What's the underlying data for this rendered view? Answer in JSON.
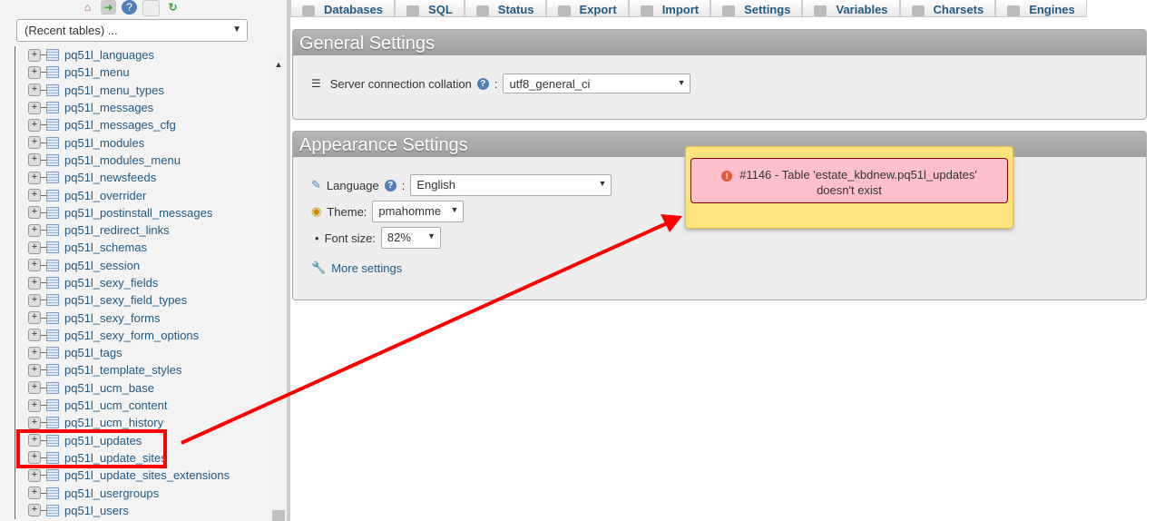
{
  "sidebar": {
    "recent_tables": "(Recent tables) ...",
    "tables": [
      "pq51l_languages",
      "pq51l_menu",
      "pq51l_menu_types",
      "pq51l_messages",
      "pq51l_messages_cfg",
      "pq51l_modules",
      "pq51l_modules_menu",
      "pq51l_newsfeeds",
      "pq51l_overrider",
      "pq51l_postinstall_messages",
      "pq51l_redirect_links",
      "pq51l_schemas",
      "pq51l_session",
      "pq51l_sexy_fields",
      "pq51l_sexy_field_types",
      "pq51l_sexy_forms",
      "pq51l_sexy_form_options",
      "pq51l_tags",
      "pq51l_template_styles",
      "pq51l_ucm_base",
      "pq51l_ucm_content",
      "pq51l_ucm_history",
      "pq51l_updates",
      "pq51l_update_sites",
      "pq51l_update_sites_extensions",
      "pq51l_usergroups",
      "pq51l_users"
    ]
  },
  "tabs": [
    "Databases",
    "SQL",
    "Status",
    "Export",
    "Import",
    "Settings",
    "Variables",
    "Charsets",
    "Engines"
  ],
  "general": {
    "title": "General Settings",
    "collation_label": "Server connection collation",
    "collation_value": "utf8_general_ci"
  },
  "appearance": {
    "title": "Appearance Settings",
    "language_label": "Language",
    "language_value": "English",
    "theme_label": "Theme:",
    "theme_value": "pmahomme",
    "fontsize_label": "Font size:",
    "fontsize_value": "82%",
    "more_settings": "More settings"
  },
  "error": {
    "line1": "#1146 - Table 'estate_kbdnew.pq51l_updates'",
    "line2": "doesn't exist"
  },
  "colors": {
    "annotation": "#ff0000",
    "error_bg": "#ffc0cb",
    "notice_bg": "#ffe47e"
  }
}
